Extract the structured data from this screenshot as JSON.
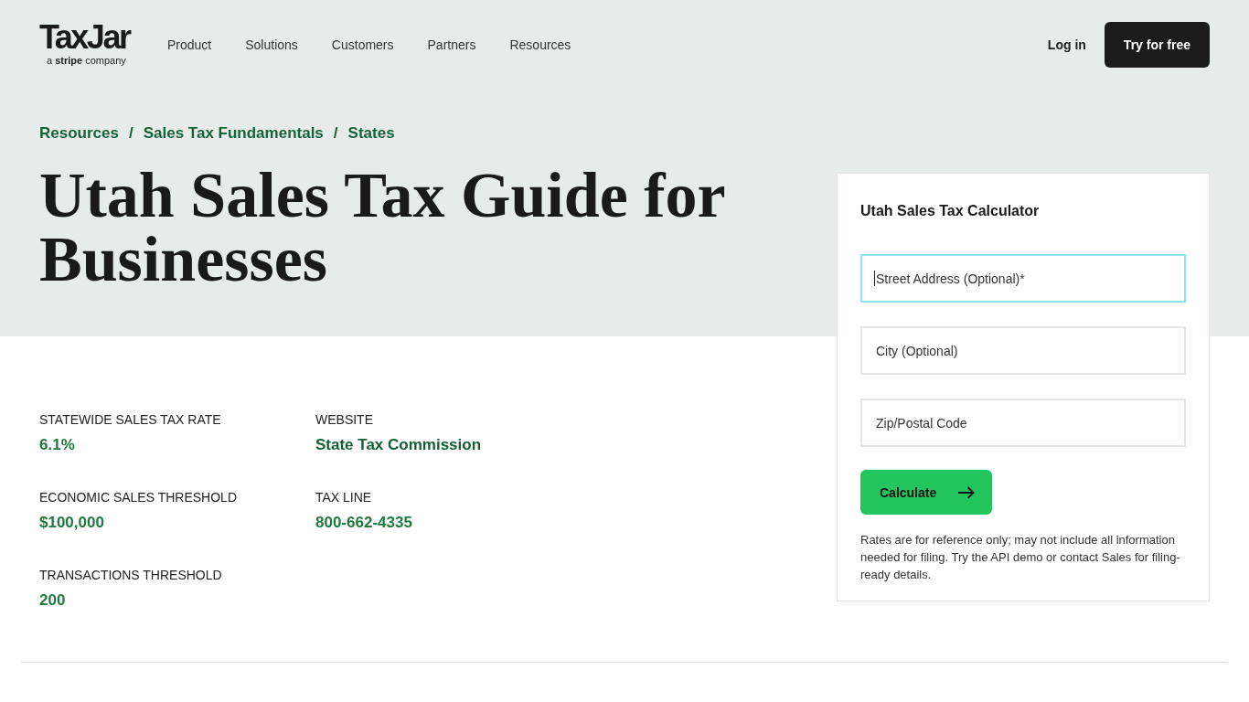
{
  "header": {
    "logo": {
      "wordmark": "TaxJar",
      "tagline": "a **stripe** company"
    },
    "nav": [
      "Product",
      "Solutions",
      "Customers",
      "Partners",
      "Resources"
    ],
    "login": "Log in",
    "cta": "Try for free"
  },
  "breadcrumb": [
    {
      "kind": "link",
      "label": "Resources"
    },
    {
      "kind": "separator",
      "label": "/"
    },
    {
      "kind": "link",
      "label": "Sales Tax Fundamentals"
    },
    {
      "kind": "separator",
      "label": "/"
    },
    {
      "kind": "link",
      "label": "States"
    }
  ],
  "title": "Utah Sales Tax Guide for Businesses",
  "stat_columns": [
    {
      "items": [
        {
          "label": "STATEWIDE SALES TAX RATE",
          "value": "6.1%",
          "kind": "text"
        },
        {
          "label": "ECONOMIC SALES THRESHOLD",
          "value": "$100,000",
          "kind": "text"
        },
        {
          "label": "TRANSACTIONS THRESHOLD",
          "value": "200",
          "kind": "text"
        }
      ]
    },
    {
      "items": [
        {
          "label": "WEBSITE",
          "value": "State Tax Commission",
          "kind": "link"
        },
        {
          "label": "TAX LINE",
          "value": "800-662-4335",
          "kind": "text"
        }
      ]
    }
  ],
  "calculator": {
    "title": "Utah Sales Tax Calculator",
    "fields": [
      {
        "placeholder": "Street Address (Optional)*",
        "focused": true
      },
      {
        "placeholder": "City (Optional)",
        "focused": false
      },
      {
        "placeholder": "Zip/Postal Code",
        "focused": false
      }
    ],
    "button": "Calculate",
    "note": "Rates are for reference only; may not include all information needed for filing. Try the API demo or contact Sales for filing-ready details."
  }
}
